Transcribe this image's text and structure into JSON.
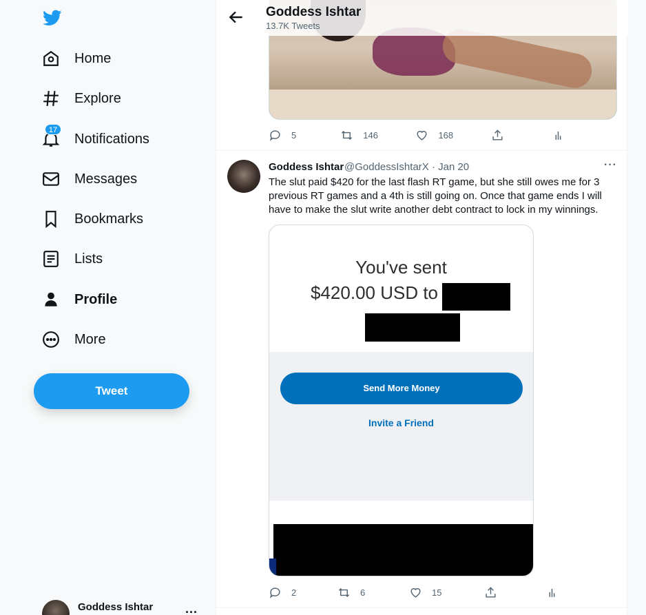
{
  "nav": {
    "items": [
      {
        "label": "Home",
        "icon": "home-icon"
      },
      {
        "label": "Explore",
        "icon": "hashtag-icon"
      },
      {
        "label": "Notifications",
        "icon": "bell-icon",
        "badge": "17"
      },
      {
        "label": "Messages",
        "icon": "mail-icon"
      },
      {
        "label": "Bookmarks",
        "icon": "bookmark-icon"
      },
      {
        "label": "Lists",
        "icon": "list-icon"
      },
      {
        "label": "Profile",
        "icon": "person-icon"
      },
      {
        "label": "More",
        "icon": "more-circle-icon"
      }
    ],
    "tweet_button": "Tweet",
    "account_name": "Goddess Ishtar",
    "account_more": "..."
  },
  "header": {
    "title": "Goddess Ishtar",
    "subtitle": "13.7K Tweets"
  },
  "tweet1": {
    "replies": "5",
    "retweets": "146",
    "likes": "168"
  },
  "tweet2": {
    "name": "Goddess Ishtar",
    "handle_date": "@GoddessIshtarX · Jan 20",
    "more": "···",
    "text": "The slut paid $420 for the last flash RT game, but she still owes me for 3 previous RT games and a 4th is  still going on. Once that game ends I will have to make the slut write another debt contract to lock in my winnings.",
    "media": {
      "sent_line": "You've sent",
      "amount_line": "$420.00 USD to",
      "send_button": "Send More Money",
      "invite_link": "Invite a Friend"
    },
    "replies": "2",
    "retweets": "6",
    "likes": "15"
  },
  "colors": {
    "brand": "#1d9bf0",
    "paypal_blue": "#0070ba"
  }
}
